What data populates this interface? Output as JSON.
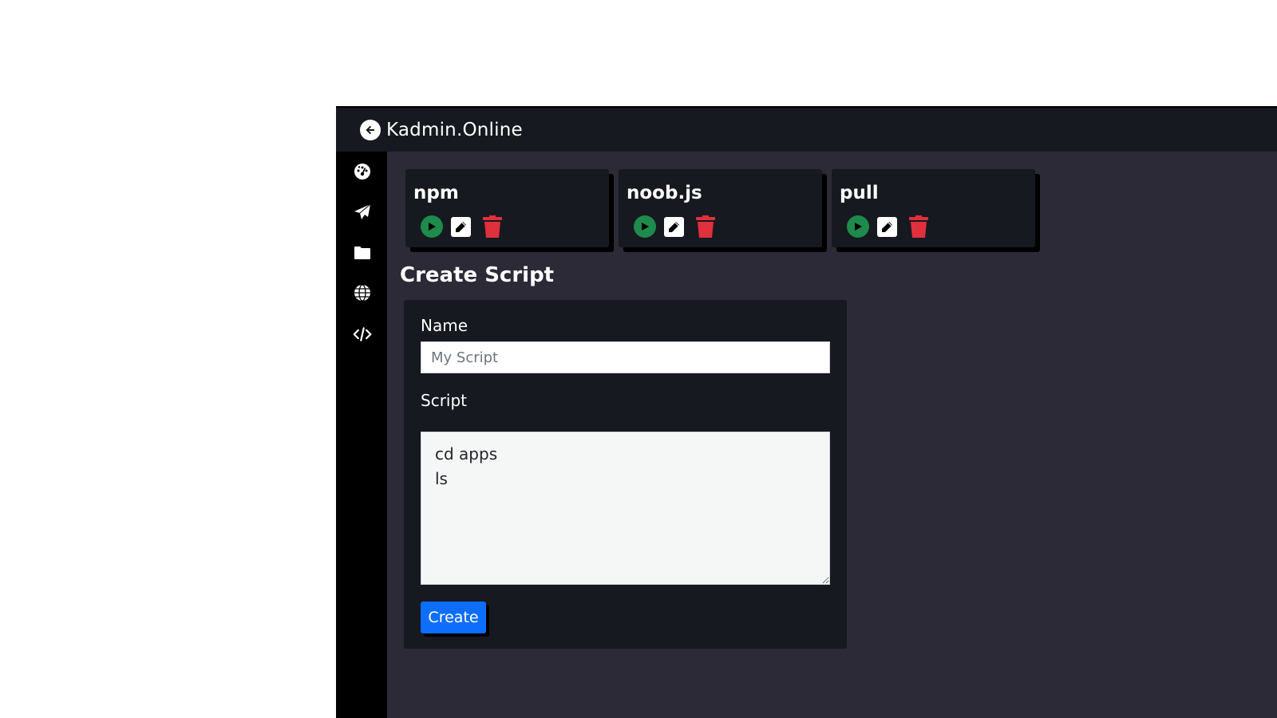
{
  "app": {
    "title": "Kadmin.Online",
    "back_icon": "arrow-left-circle-icon"
  },
  "sidebar": {
    "items": [
      {
        "name": "dashboard",
        "icon": "gauge-icon"
      },
      {
        "name": "send",
        "icon": "paper-plane-icon"
      },
      {
        "name": "files",
        "icon": "folder-icon"
      },
      {
        "name": "domains",
        "icon": "globe-icon"
      },
      {
        "name": "scripts",
        "icon": "code-icon"
      }
    ]
  },
  "scripts": [
    {
      "name": "npm"
    },
    {
      "name": "noob.js"
    },
    {
      "name": "pull"
    }
  ],
  "script_actions": {
    "run_icon": "play-circle-icon",
    "edit_icon": "pencil-square-icon",
    "delete_icon": "trash-icon"
  },
  "create_form": {
    "heading": "Create Script",
    "name_label": "Name",
    "name_placeholder": "My Script",
    "name_value": "",
    "script_label": "Script",
    "script_value": "cd apps\nls",
    "submit_label": "Create"
  },
  "colors": {
    "topbar": "#16191f",
    "sidebar": "#000000",
    "content_bg": "#2b2a36",
    "card_bg": "#16191f",
    "run": "#1e8a4c",
    "delete": "#e0303c",
    "primary": "#0d6efd"
  }
}
